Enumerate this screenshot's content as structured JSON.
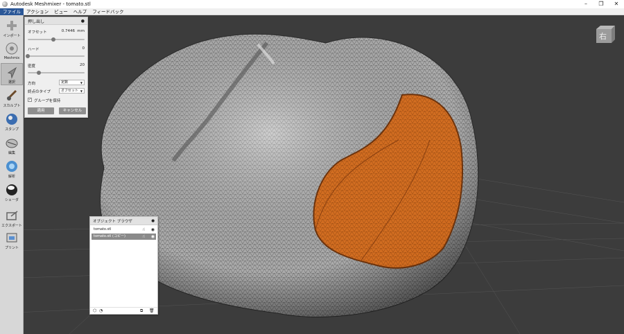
{
  "window": {
    "title": "Autodesk Meshmixer - tomato.stl",
    "controls": [
      "–",
      "❐",
      "✕"
    ]
  },
  "menu": [
    "ファイル",
    "アクション",
    "ビュー",
    "ヘルプ",
    "フィードバック"
  ],
  "toolbar": [
    {
      "label": "インポート",
      "icon": "plus-icon"
    },
    {
      "label": "Meshmix",
      "icon": "meshmix-icon"
    },
    {
      "label": "選択",
      "icon": "select-arrow-icon",
      "selected": true
    },
    {
      "label": "スカルプト",
      "icon": "brush-icon"
    },
    {
      "label": "スタンプ",
      "icon": "stamp-icon"
    },
    {
      "label": "編集",
      "icon": "edit-icon"
    },
    {
      "label": "解析",
      "icon": "analysis-icon"
    },
    {
      "label": "シェーダ",
      "icon": "shader-icon"
    },
    {
      "label": "エクスポート",
      "icon": "export-icon"
    },
    {
      "label": "プリント",
      "icon": "print-icon"
    }
  ],
  "extrude_panel": {
    "title": "押し出し",
    "offset_label": "オフセット",
    "offset_value": "0.7446",
    "offset_unit": "mm",
    "offset_level": 0.45,
    "harden_label": "ハード",
    "harden_value": "0",
    "harden_level": 0.0,
    "density_label": "密度",
    "density_value": "20",
    "density_level": 0.2,
    "direction_label": "方向",
    "direction_value": "定数",
    "endtype_label": "終点のタイプ",
    "endtype_value": "オフセット",
    "preserve_groups_label": "グループを保持",
    "preserve_groups_checked": true,
    "apply_label": "適用",
    "cancel_label": "キャンセル"
  },
  "object_browser": {
    "title": "オブジェクト ブラウザ",
    "items": [
      {
        "name": "tomato.stl",
        "selected": false
      },
      {
        "name": "tomato.stl (コピー)",
        "selected": true
      }
    ]
  },
  "viewcube": {
    "face_label": "右"
  },
  "colors": {
    "selection": "#d86a18",
    "mesh": "#a9a9a9",
    "background": "#3c3c3c",
    "menu_active": "#2b5797"
  }
}
